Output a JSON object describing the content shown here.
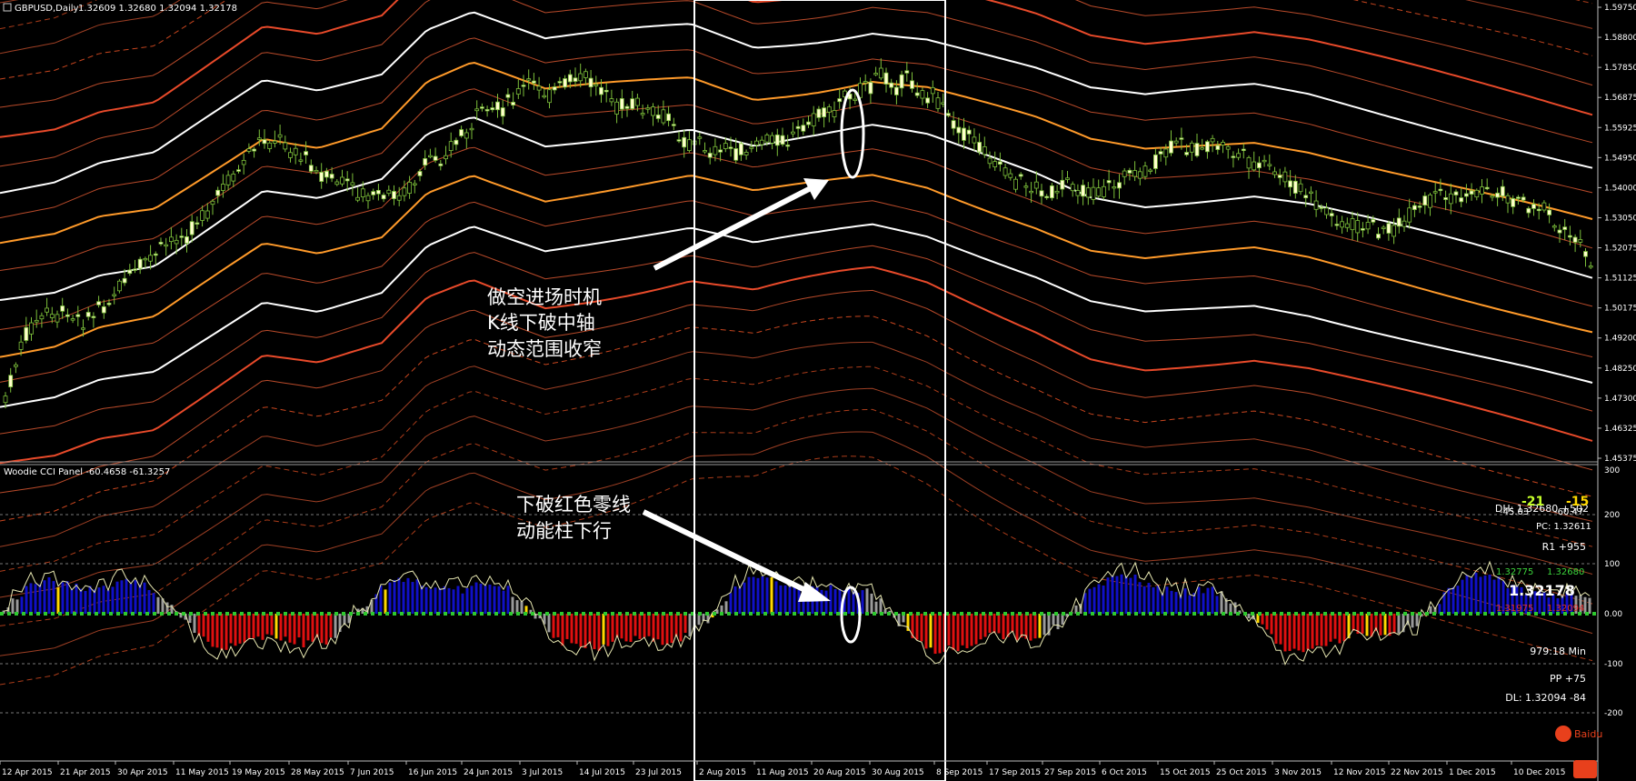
{
  "header": {
    "symbol": "GBPUSD,Daily",
    "ohlc": "1.32609 1.32680 1.32094 1.32178"
  },
  "price_axis": [
    "1.59750",
    "1.58800",
    "1.57850",
    "1.56875",
    "1.55925",
    "1.54950",
    "1.54000",
    "1.53050",
    "1.52075",
    "1.51125",
    "1.50175",
    "1.49200",
    "1.48250",
    "1.47300",
    "1.46325",
    "1.45375"
  ],
  "price_range": [
    1.45375,
    1.5975
  ],
  "indicator": {
    "title": "Woodie CCI Panel -60.4658 -61.3257",
    "levels": [
      "300",
      "200",
      "100",
      "0.00",
      "-100",
      "-200"
    ],
    "range": [
      -300,
      300
    ]
  },
  "date_axis": [
    "12 Apr 2015",
    "21 Apr 2015",
    "30 Apr 2015",
    "11 May 2015",
    "19 May 2015",
    "28 May 2015",
    "7 Jun 2015",
    "16 Jun 2015",
    "24 Jun 2015",
    "3 Jul 2015",
    "14 Jul 2015",
    "23 Jul 2015",
    "2 Aug 2015",
    "11 Aug 2015",
    "20 Aug 2015",
    "30 Aug 2015",
    "8 Sep 2015",
    "17 Sep 2015",
    "27 Sep 2015",
    "6 Oct 2015",
    "15 Oct 2015",
    "25 Oct 2015",
    "3 Nov 2015",
    "12 Nov 2015",
    "22 Nov 2015",
    "1 Dec 2015",
    "10 Dec 2015"
  ],
  "annotations": {
    "upper": [
      "做空进场时机",
      "K线下破中轴",
      "动态范围收窄"
    ],
    "lower": [
      "下破红色零线",
      "动能柱下行"
    ]
  },
  "cci_panel": {
    "dh": "DH: 1.32680 +502",
    "cci_fast": "-21",
    "cci_slow": "-15",
    "cci_fast_val": "-45.03",
    "cci_slow_val": "-60.47",
    "pc": "PC: 1.32611",
    "r1": "R1 +955",
    "range_low": "1.32775",
    "range_high": "1.32680",
    "price": "1.32178",
    "red_low": "1.31975",
    "red_high": "1.32094",
    "timer": "979:18 Min",
    "pp": "PP +75",
    "dl": "DL: 1.32094 -84"
  },
  "watermark": "Baidu",
  "colors": {
    "background": "#000000",
    "candle_up": "#7cbf3a",
    "candle_body": "#ffffcc",
    "band_white": "#ffffff",
    "band_orange": "#ff8c1a",
    "band_red": "#e84a2a",
    "cci_blue": "#1010c8",
    "cci_red": "#e01010",
    "cci_gray": "#9a9a9a",
    "cci_yellow": "#ffd800",
    "zero_line": "#2ec82e"
  }
}
